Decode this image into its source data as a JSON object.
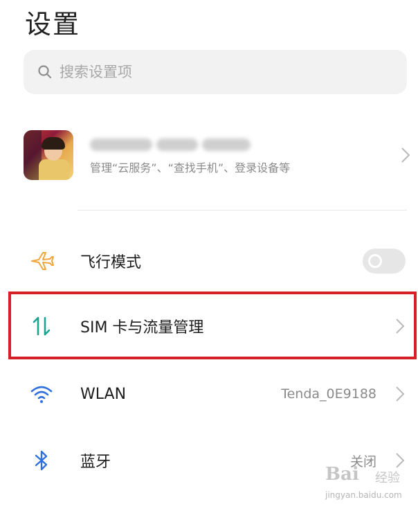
{
  "header": {
    "title": "设置"
  },
  "search": {
    "placeholder": "搜索设置项"
  },
  "account": {
    "description": "管理“云服务”、“查找手机”、登录设备等"
  },
  "settings": [
    {
      "label": "飞行模式",
      "icon": "airplane-icon",
      "control": "toggle",
      "state": "off"
    },
    {
      "label": "SIM 卡与流量管理",
      "icon": "sim-data-icon",
      "highlighted": true
    },
    {
      "label": "WLAN",
      "icon": "wifi-icon",
      "value": "Tenda_0E9188"
    },
    {
      "label": "蓝牙",
      "icon": "bluetooth-icon",
      "value": "关闭"
    }
  ],
  "watermark": {
    "logo": "Bai",
    "text": "经验",
    "url": "jingyan.baidu.com"
  },
  "colors": {
    "highlight": "#d61f26",
    "sim_icon": "#1aa38f",
    "airplane_icon": "#f0a63a",
    "wifi_icon": "#2f6fde",
    "bluetooth_icon": "#2f6fde"
  }
}
